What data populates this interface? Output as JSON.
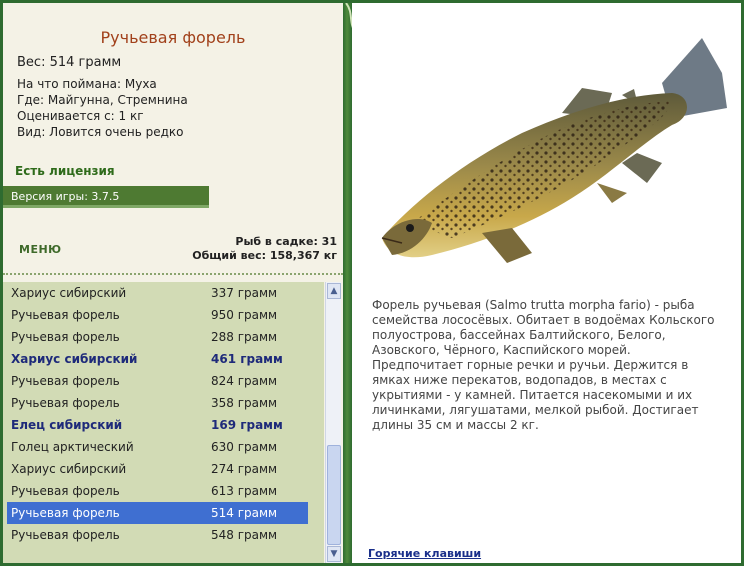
{
  "fish": {
    "title": "Ручьевая форель",
    "weight": "Вес: 514 грамм",
    "caught_with": "На что поймана: Муха",
    "location": "Где: Майгунна, Стремнина",
    "value": "Оценивается с: 1 кг",
    "rarity": "Вид: Ловится очень редко"
  },
  "license": "Есть лицензия",
  "version": "Версия игры: 3.7.5",
  "menu_label": "МЕНЮ",
  "stats": {
    "in_cage": "Рыб в садке: 31",
    "total_weight": "Общий вес: 158,367 кг"
  },
  "fish_list": [
    {
      "name": "Хариус сибирский",
      "weight": "337 грамм",
      "style": "normal"
    },
    {
      "name": "Ручьевая форель",
      "weight": "950 грамм",
      "style": "normal"
    },
    {
      "name": "Ручьевая форель",
      "weight": "288 грамм",
      "style": "normal"
    },
    {
      "name": "Хариус сибирский",
      "weight": "461 грамм",
      "style": "bold"
    },
    {
      "name": "Ручьевая форель",
      "weight": "824 грамм",
      "style": "normal"
    },
    {
      "name": "Ручьевая форель",
      "weight": "358 грамм",
      "style": "normal"
    },
    {
      "name": "Елец сибирский",
      "weight": "169 грамм",
      "style": "bold"
    },
    {
      "name": "Голец арктический",
      "weight": "630 грамм",
      "style": "normal"
    },
    {
      "name": "Хариус сибирский",
      "weight": "274 грамм",
      "style": "normal"
    },
    {
      "name": "Ручьевая форель",
      "weight": "613 грамм",
      "style": "normal"
    },
    {
      "name": "Ручьевая форель",
      "weight": "514 грамм",
      "style": "selected"
    },
    {
      "name": "Ручьевая форель",
      "weight": "548 грамм",
      "style": "normal"
    }
  ],
  "description": "Форель ручьевая (Salmo trutta morpha fario) - рыба семейства лососёвых. Обитает в водоёмах Кольского полуострова, бассейнах Балтийского, Белого, Азовского, Чёрного, Каспийского морей. Предпочитает горные речки и ручьи. Держится в ямках ниже перекатов, водопадов, в местах с укрытиями - у камней. Питается насекомыми и их личинками, лягушатами, мелкой рыбой. Достигает длины 35 см и массы 2 кг.",
  "hotkeys_label": "Горячие клавиши",
  "icons": {
    "scroll_up": "chevron-up-icon",
    "scroll_down": "chevron-down-icon",
    "vine": "vine-decoration-icon",
    "fish": "trout-image"
  },
  "colors": {
    "accent_green": "#2e6b30",
    "title_color": "#a1411b",
    "selected_row": "#3f6fd1",
    "list_bg": "#d2dbb5"
  }
}
